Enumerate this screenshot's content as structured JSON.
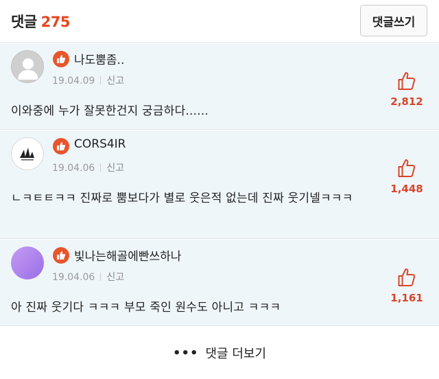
{
  "header": {
    "title": "댓글",
    "count": "275",
    "write_button": "댓글쓰기"
  },
  "comments": [
    {
      "nickname": "나도뿜좀..",
      "date": "19.04.09",
      "report": "신고",
      "text": "이와중에 누가 잘못한건지 궁금하다......",
      "likes": "2,812",
      "avatar": "default-profile-icon"
    },
    {
      "nickname": "CORS4IR",
      "date": "19.04.06",
      "report": "신고",
      "text": "ㄴㅋㅌㅌㅋㅋ 진짜로 뿜보다가 별로 웃은적 없는데 진짜 웃기넬ㅋㅋㅋ",
      "likes": "1,448",
      "avatar": "sail-logo-icon"
    },
    {
      "nickname": "빛나는해골에빤쓰하나",
      "date": "19.04.06",
      "report": "신고",
      "text": "아 진짜 웃기다 ㅋㅋㅋ 부모 죽인 원수도 아니고 ㅋㅋㅋ",
      "likes": "1,161",
      "avatar": "purple-profile"
    }
  ],
  "more": {
    "dots": "•••",
    "label": "댓글 더보기"
  },
  "colors": {
    "accent": "#e8451f",
    "comment_bg": "#eff6f9",
    "like": "#d8452a"
  }
}
